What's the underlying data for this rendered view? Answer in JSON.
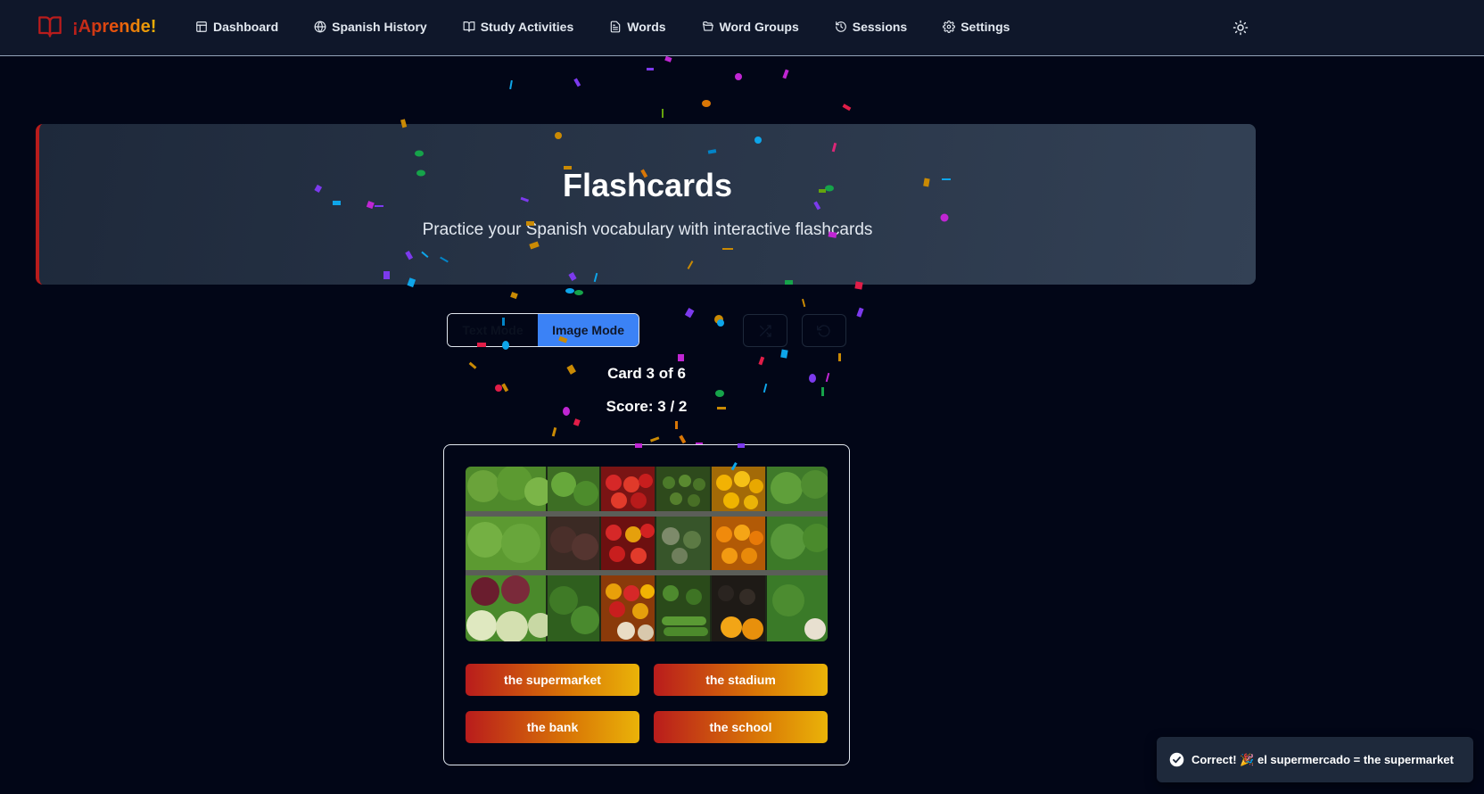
{
  "app": {
    "brand_name": "¡Aprende!",
    "brand_icon": "book-open-icon"
  },
  "nav": {
    "items": [
      {
        "label": "Dashboard",
        "icon": "layout-icon"
      },
      {
        "label": "Spanish History",
        "icon": "globe-icon"
      },
      {
        "label": "Study Activities",
        "icon": "book-open-icon"
      },
      {
        "label": "Words",
        "icon": "file-text-icon"
      },
      {
        "label": "Word Groups",
        "icon": "folder-open-icon"
      },
      {
        "label": "Sessions",
        "icon": "history-icon"
      },
      {
        "label": "Settings",
        "icon": "gear-icon"
      }
    ],
    "theme_toggle_icon": "sun-icon"
  },
  "hero": {
    "title": "Flashcards",
    "subtitle": "Practice your Spanish vocabulary with interactive flashcards"
  },
  "controls": {
    "text_mode_label": "Text Mode",
    "image_mode_label": "Image Mode",
    "active_mode": "image",
    "shuffle_icon": "shuffle-icon",
    "reset_icon": "rotate-ccw-icon"
  },
  "progress": {
    "card_label": "Card 3 of 6",
    "score_label": "Score: 3 / 2"
  },
  "flashcard": {
    "image_subject": "produce-shelves-image",
    "options": [
      {
        "label": "the supermarket"
      },
      {
        "label": "the stadium"
      },
      {
        "label": "the bank"
      },
      {
        "label": "the school"
      }
    ]
  },
  "toast": {
    "icon": "check-circle-icon",
    "message": "Correct! 🎉 el supermercado = the supermarket"
  },
  "colors": {
    "background": "#020617",
    "navbar": "#0f172a",
    "accent_red": "#b91c1c",
    "accent_yellow": "#eab308",
    "active_mode": "#3b82f6"
  }
}
